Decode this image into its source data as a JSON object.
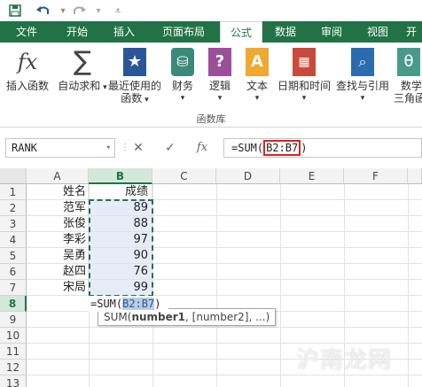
{
  "quick_access": {
    "save_icon": "save-icon",
    "undo_icon": "undo-icon",
    "redo_icon": "redo-icon"
  },
  "tabs": [
    "文件",
    "开始",
    "插入",
    "页面布局",
    "公式",
    "数据",
    "审阅",
    "视图",
    "开"
  ],
  "active_tab": "公式",
  "ribbon": {
    "buttons": [
      {
        "label": "插入函数",
        "icon": "fx-icon"
      },
      {
        "label": "自动求和",
        "sub": "",
        "icon": "sigma-icon"
      },
      {
        "label": "最近使用的",
        "sub": "函数",
        "icon": "star-icon"
      },
      {
        "label": "财务",
        "icon": "coins-icon"
      },
      {
        "label": "逻辑",
        "icon": "question-icon"
      },
      {
        "label": "文本",
        "icon": "text-icon"
      },
      {
        "label": "日期和时间",
        "icon": "calendar-icon"
      },
      {
        "label": "查找与引用",
        "icon": "lookup-icon"
      },
      {
        "label": "数学",
        "sub": "三角函",
        "icon": "theta-icon"
      }
    ],
    "group_label": "函数库"
  },
  "formula_bar": {
    "name_box": "RANK",
    "cancel_icon": "cancel-icon",
    "enter_icon": "check-icon",
    "fx_icon": "fx-icon",
    "formula_prefix": "=SUM(",
    "formula_range": "B2:B7",
    "formula_suffix": ")"
  },
  "sheet": {
    "columns": [
      "A",
      "B",
      "C",
      "D",
      "E",
      "F"
    ],
    "rows": [
      "1",
      "2",
      "3",
      "4",
      "5",
      "6",
      "7",
      "8",
      "9",
      "10",
      "11",
      "12",
      "13"
    ],
    "header_row": {
      "a": "姓名",
      "b": "成绩"
    },
    "data": [
      {
        "name": "范军",
        "score": "89"
      },
      {
        "name": "张俊",
        "score": "88"
      },
      {
        "name": "李彩",
        "score": "97"
      },
      {
        "name": "吴勇",
        "score": "90"
      },
      {
        "name": "赵四",
        "score": "76"
      },
      {
        "name": "宋局",
        "score": "99"
      }
    ],
    "active_cell_prefix": "=SUM(",
    "active_cell_range": "B2:B7",
    "active_cell_suffix": ")",
    "tooltip_fn": "SUM(",
    "tooltip_arg1": "number1",
    "tooltip_rest": ", [number2], ...)"
  },
  "watermark": "沪南龙网",
  "colors": {
    "excel_green": "#217346",
    "range_fill": "#e6ecf7",
    "red_box": "#e02020"
  }
}
